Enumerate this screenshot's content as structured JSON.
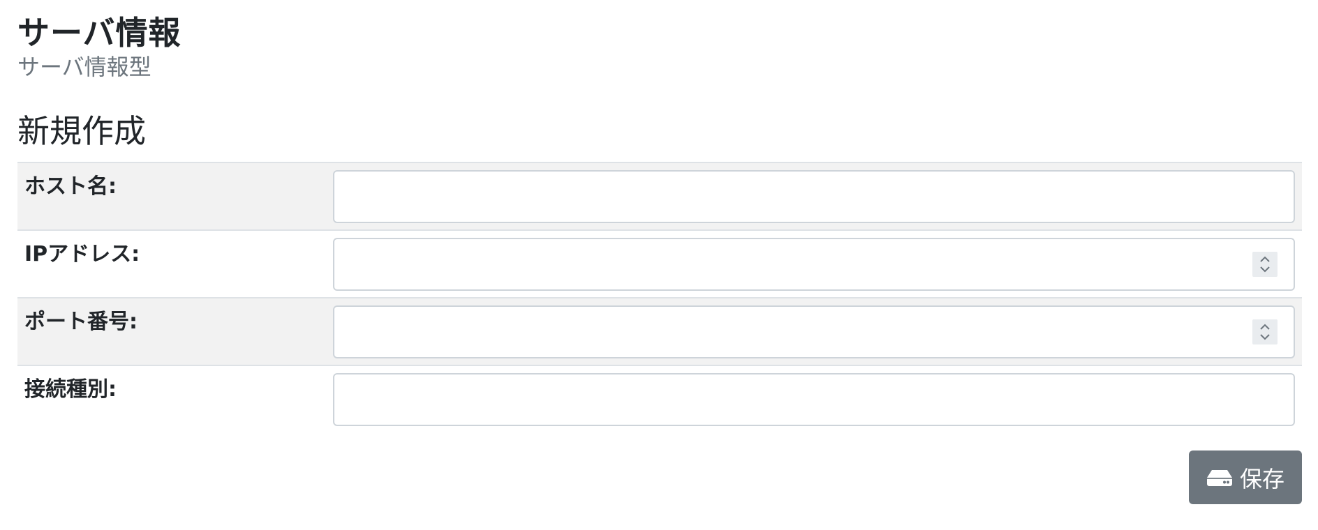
{
  "header": {
    "title": "サーバ情報",
    "subtitle": "サーバ情報型"
  },
  "form": {
    "section_title": "新規作成",
    "fields": [
      {
        "label": "ホスト名:",
        "value": "",
        "type": "text"
      },
      {
        "label": "IPアドレス:",
        "value": "",
        "type": "number"
      },
      {
        "label": "ポート番号:",
        "value": "",
        "type": "number"
      },
      {
        "label": "接続種別:",
        "value": "",
        "type": "text"
      }
    ]
  },
  "actions": {
    "save_label": "保存",
    "save_icon": "hdd-icon"
  },
  "colors": {
    "button_bg": "#6c757d",
    "row_shade": "#f2f2f2",
    "subtitle": "#6c757d"
  }
}
